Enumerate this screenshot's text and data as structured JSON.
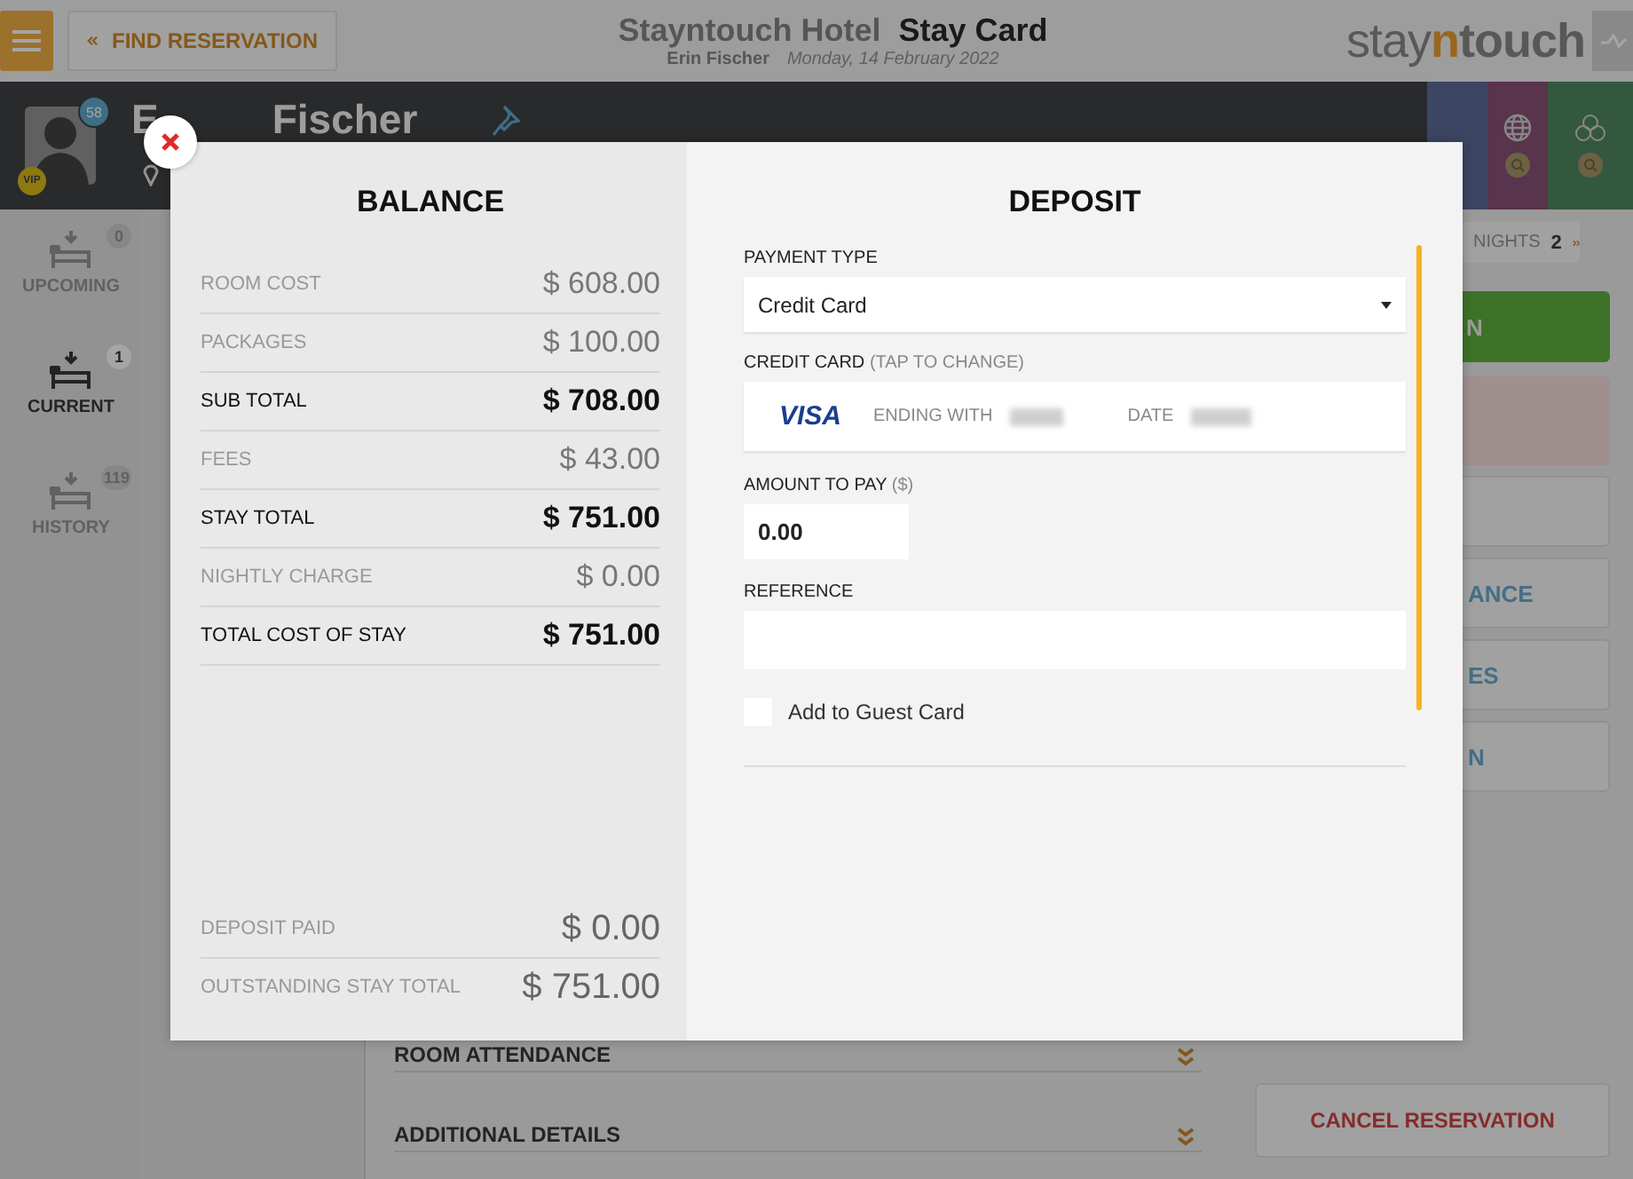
{
  "header": {
    "find_button": "FIND RESERVATION",
    "hotel": "Stayntouch Hotel",
    "page_title": "Stay Card",
    "guest_name": "Erin Fischer",
    "date": "Monday, 14 February 2022",
    "logo": [
      "stay",
      "n",
      "touch"
    ]
  },
  "guest": {
    "first_name": "E",
    "last_name": "Fischer",
    "loyalty_badge": "58",
    "vip_badge": "VIP"
  },
  "sidebar": [
    {
      "label": "UPCOMING",
      "count": "0",
      "selected": false
    },
    {
      "label": "CURRENT",
      "count": "1",
      "selected": true
    },
    {
      "label": "HISTORY",
      "count": "119",
      "selected": false
    }
  ],
  "right_panel": {
    "nights_label": "NIGHTS",
    "nights": "2",
    "actions": [
      {
        "kind": "success",
        "label": "N"
      },
      {
        "kind": "alert"
      },
      {
        "kind": "plain"
      },
      {
        "kind": "plain",
        "label": "ANCE"
      },
      {
        "kind": "plain",
        "label": "ES"
      },
      {
        "kind": "plain",
        "label": "N"
      }
    ],
    "cancel_button": "CANCEL RESERVATION"
  },
  "sections": [
    "ROOM ATTENDANCE",
    "ADDITIONAL DETAILS"
  ],
  "modal": {
    "balance": {
      "title": "BALANCE",
      "rows": [
        {
          "label": "ROOM COST",
          "value": "$ 608.00",
          "kind": "item"
        },
        {
          "label": "PACKAGES",
          "value": "$ 100.00",
          "kind": "item"
        },
        {
          "label": "SUB TOTAL",
          "value": "$ 708.00",
          "kind": "total"
        },
        {
          "label": "FEES",
          "value": "$ 43.00",
          "kind": "item"
        },
        {
          "label": "STAY TOTAL",
          "value": "$ 751.00",
          "kind": "total"
        },
        {
          "label": "NIGHTLY CHARGE",
          "value": "$ 0.00",
          "kind": "item"
        },
        {
          "label": "TOTAL COST OF STAY",
          "value": "$ 751.00",
          "kind": "total"
        }
      ],
      "summary": [
        {
          "label": "DEPOSIT PAID",
          "value": "$ 0.00"
        },
        {
          "label": "OUTSTANDING STAY TOTAL",
          "value": "$ 751.00"
        }
      ]
    },
    "deposit": {
      "title": "DEPOSIT",
      "payment_type": {
        "label": "PAYMENT TYPE",
        "value": "Credit Card"
      },
      "credit_card": {
        "label": "CREDIT CARD",
        "hint": "(TAP TO CHANGE)",
        "brand": "VISA",
        "ending_label": "ENDING WITH",
        "date_label": "DATE"
      },
      "amount": {
        "label": "AMOUNT TO PAY",
        "hint": "($)",
        "value": "0.00"
      },
      "reference": {
        "label": "REFERENCE"
      },
      "add_to_guest_card": {
        "label": "Add to Guest Card",
        "checked": false
      }
    }
  }
}
